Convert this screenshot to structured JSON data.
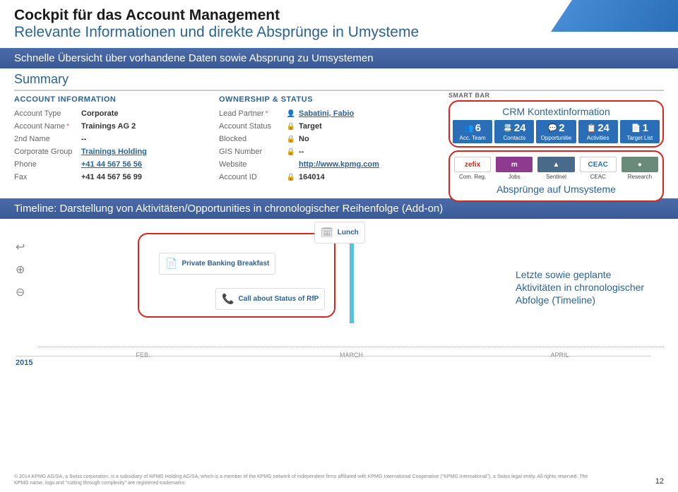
{
  "header": {
    "title": "Cockpit für das Account Management",
    "subtitle": "Relevante Informationen und direkte Absprünge in Umysteme"
  },
  "banner1": "Schnelle Übersicht über vorhandene Daten sowie Absprung zu Umsystemen",
  "summary": {
    "title": "Summary",
    "section_label": "ACCOUNT INFORMATION",
    "ownership_label": "OWNERSHIP & STATUS",
    "rows_left": [
      {
        "label": "Account Type",
        "value": "Corporate"
      },
      {
        "label": "Account Name",
        "star": true,
        "value": "Trainings AG 2"
      },
      {
        "label": "2nd Name",
        "value": "--"
      },
      {
        "label": "Corporate Group",
        "value": "Trainings Holding",
        "link": true
      },
      {
        "label": "Phone",
        "value": "+41 44 567 56 56",
        "link": true
      },
      {
        "label": "Fax",
        "value": "+41 44 567 56 99"
      }
    ],
    "rows_right": [
      {
        "label": "Lead Partner",
        "star": true,
        "icon": "👤",
        "value": "Sabatini, Fabio",
        "link": true
      },
      {
        "label": "Account Status",
        "icon": "🔒",
        "value": "Target"
      },
      {
        "label": "Blocked",
        "icon": "🔒",
        "value": "No"
      },
      {
        "label": "GIS Number",
        "icon": "🔒",
        "value": "--"
      },
      {
        "label": "Website",
        "icon": "",
        "value": "http://www.kpmg.com",
        "link": true
      },
      {
        "label": "Account ID",
        "icon": "🔒",
        "value": "164014"
      }
    ]
  },
  "smartbar": {
    "label": "SMART BAR",
    "annotation_top": "CRM Kontextinformation",
    "annotation_bottom": "Absprünge auf Umsysteme",
    "tiles": [
      {
        "icon": "👥",
        "num": "6",
        "label": "Acc. Team"
      },
      {
        "icon": "📇",
        "num": "24",
        "label": "Contacts"
      },
      {
        "icon": "💬",
        "num": "2",
        "label": "Opportunitie"
      },
      {
        "icon": "📋",
        "num": "24",
        "label": "Activities"
      },
      {
        "icon": "📄",
        "num": "1",
        "label": "Target List"
      }
    ],
    "ext": [
      {
        "label": "Com. Reg.",
        "brand": "zefix",
        "bg": "#fff",
        "fg": "#d9261c",
        "border": true
      },
      {
        "label": "Jobs",
        "brand": "m",
        "bg": "#8e3a8e",
        "fg": "#fff"
      },
      {
        "label": "Sentinel",
        "brand": "▲",
        "bg": "#4a6a8a",
        "fg": "#fff"
      },
      {
        "label": "CEAC",
        "brand": "CEAC",
        "bg": "#fff",
        "fg": "#2a6eb8",
        "border": true
      },
      {
        "label": "Research",
        "brand": "●",
        "bg": "#6a8a7a",
        "fg": "#fff"
      }
    ]
  },
  "banner2": "Timeline: Darstellung von Aktivitäten/Opportunities in chronologischer Reihenfolge (Add-on)",
  "timeline": {
    "items": [
      {
        "icon": "📄",
        "text": "Private Banking\nBreakfast"
      },
      {
        "icon": "📞",
        "text": "Call about Status of\nRfP"
      },
      {
        "icon": "📅",
        "text": "Lunch"
      }
    ],
    "months": [
      "FEB.",
      "MARCH",
      "APRIL"
    ],
    "year": "2015",
    "annotation": "Letzte sowie geplante Aktivitäten in chronologischer Abfolge (Timeline)"
  },
  "footer": {
    "text": "© 2014 KPMG AG/SA, a Swiss corporation, is a subsidiary of KPMG Holding AG/SA, which is a member of the KPMG network of independent firms affiliated with KPMG International Cooperative (\"KPMG International\"), a Swiss legal entity. All rights reserved. The KPMG name, logo and \"cutting through complexity\" are registered trademarks.",
    "page": "12"
  }
}
